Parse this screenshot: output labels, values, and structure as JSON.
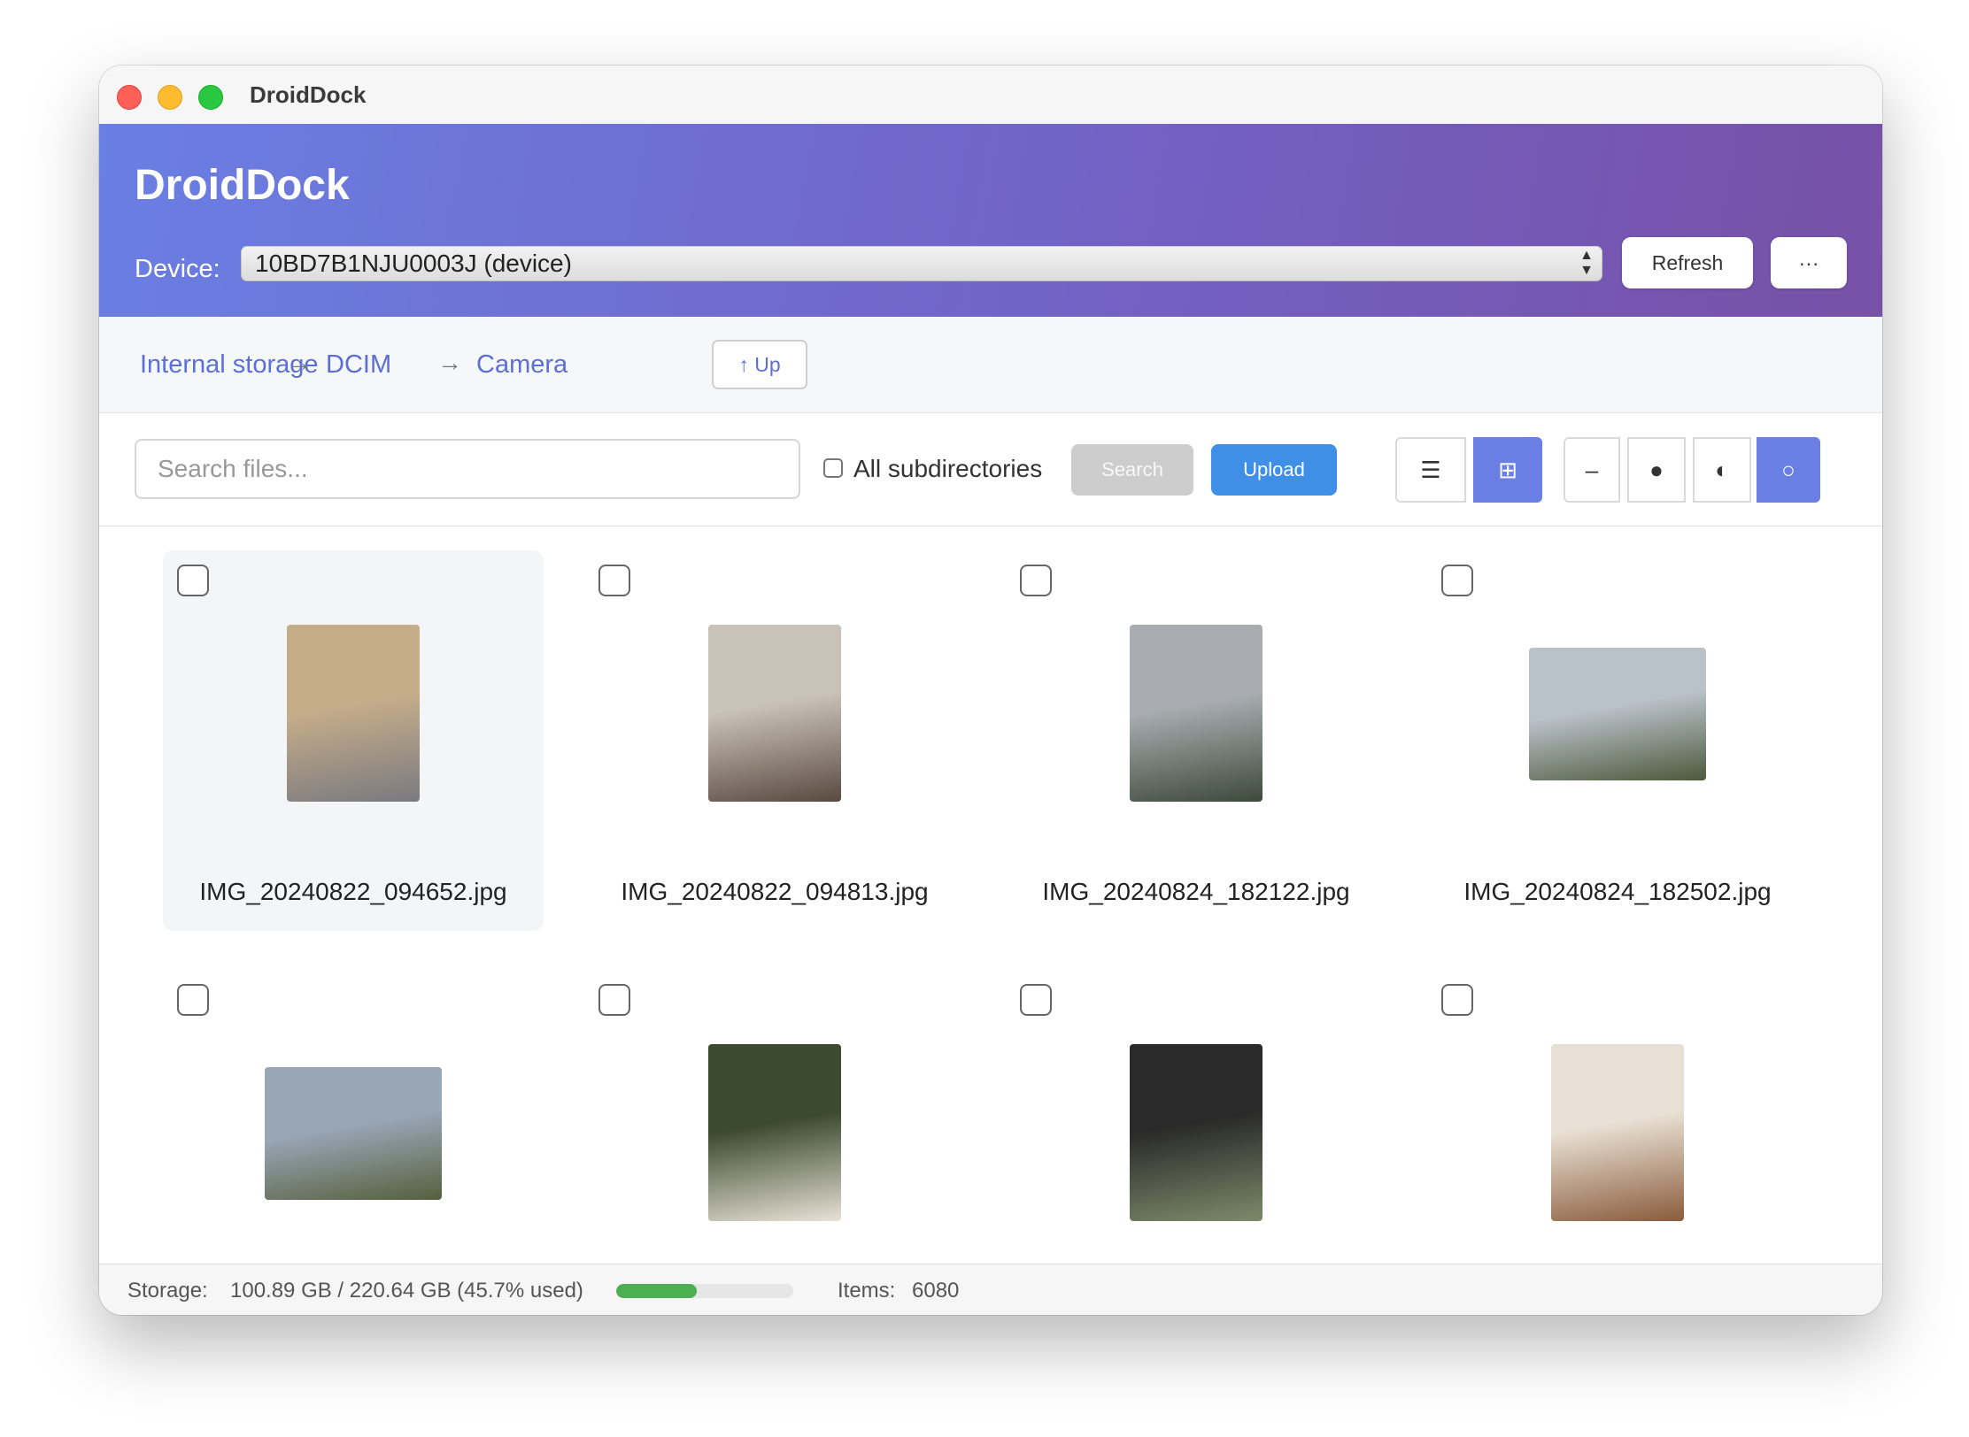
{
  "window": {
    "title": "DroidDock"
  },
  "header": {
    "app_title": "DroidDock",
    "device_label": "Device:",
    "device_value": "10BD7B1NJU0003J (device)",
    "refresh_label": "Refresh",
    "more_label": "···"
  },
  "breadcrumb": {
    "items": [
      "Internal storage",
      "DCIM",
      "Camera"
    ],
    "separator": "→",
    "up_label": "↑ Up"
  },
  "toolbar": {
    "search_placeholder": "Search files...",
    "search_value": "",
    "subdirs_label": "All subdirectories",
    "subdirs_checked": false,
    "search_button": "Search",
    "upload_button": "Upload",
    "view_list_icon": "☰",
    "view_grid_icon": "⊞",
    "view_mode": "grid",
    "size_icons": [
      "–",
      "●",
      "◐",
      "○"
    ],
    "size_selected": 3
  },
  "files": [
    {
      "name": "IMG_20240822_094652.jpg",
      "checked": false,
      "orientation": "portrait",
      "thumb_colors": [
        "#c6ad8a",
        "#7a7a80"
      ]
    },
    {
      "name": "IMG_20240822_094813.jpg",
      "checked": false,
      "orientation": "portrait",
      "thumb_colors": [
        "#c9c2b6",
        "#5a4a40"
      ]
    },
    {
      "name": "IMG_20240824_182122.jpg",
      "checked": false,
      "orientation": "portrait",
      "thumb_colors": [
        "#a9adb1",
        "#3d4a3a"
      ]
    },
    {
      "name": "IMG_20240824_182502.jpg",
      "checked": false,
      "orientation": "landscape",
      "thumb_colors": [
        "#b9c1c9",
        "#4c5a3c"
      ]
    },
    {
      "name": "",
      "checked": false,
      "orientation": "landscape",
      "thumb_colors": [
        "#98a6b6",
        "#56603e"
      ]
    },
    {
      "name": "",
      "checked": false,
      "orientation": "portrait",
      "thumb_colors": [
        "#3c4a30",
        "#e8e2d6"
      ]
    },
    {
      "name": "",
      "checked": false,
      "orientation": "portrait",
      "thumb_colors": [
        "#2a2a2a",
        "#7d8a6a"
      ]
    },
    {
      "name": "",
      "checked": false,
      "orientation": "portrait",
      "thumb_colors": [
        "#e8e0d4",
        "#8a5c3c"
      ]
    }
  ],
  "status": {
    "storage_label": "Storage:",
    "storage_value": "100.89 GB / 220.64 GB (45.7% used)",
    "storage_used_fraction": 0.457,
    "items_label": "Items:",
    "items_value": "6080"
  },
  "colors": {
    "accent": "#6a7fe3",
    "header_gradient_start": "#6a7fe3",
    "header_gradient_end": "#7751a7",
    "upload": "#3f8fe6",
    "progress": "#4caf50",
    "link": "#5b6fd6"
  }
}
